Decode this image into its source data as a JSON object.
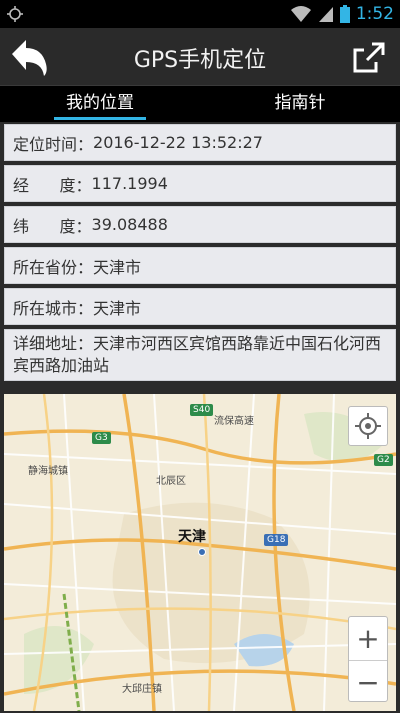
{
  "status_bar": {
    "time": "1:52"
  },
  "action_bar": {
    "title": "GPS手机定位"
  },
  "tabs": [
    {
      "label": "我的位置",
      "active": true
    },
    {
      "label": "指南针",
      "active": false
    }
  ],
  "info": {
    "time": {
      "label": "定位时间：",
      "value": "2016-12-22 13:52:27"
    },
    "lng": {
      "label": "经      度：",
      "value": "117.1994"
    },
    "lat": {
      "label": "纬      度：",
      "value": "39.08488"
    },
    "province": {
      "label": "所在省份：",
      "value": "天津市"
    },
    "city": {
      "label": "所在城市：",
      "value": "天津市"
    },
    "address": {
      "label": "详细地址：",
      "value": "天津市河西区宾馆西路靠近中国石化河西宾西路加油站"
    }
  },
  "map": {
    "city_label": "天津",
    "labels": [
      "流保高速",
      "北辰区",
      "静海城镇",
      "大邱庄镇"
    ],
    "shields": [
      "G3",
      "S40",
      "G2",
      "G18"
    ],
    "zoom_in": "+",
    "zoom_out": "−"
  },
  "colors": {
    "accent": "#33b5e5",
    "row_bg": "#e9eaee",
    "map_bg": "#f3ecd9"
  }
}
